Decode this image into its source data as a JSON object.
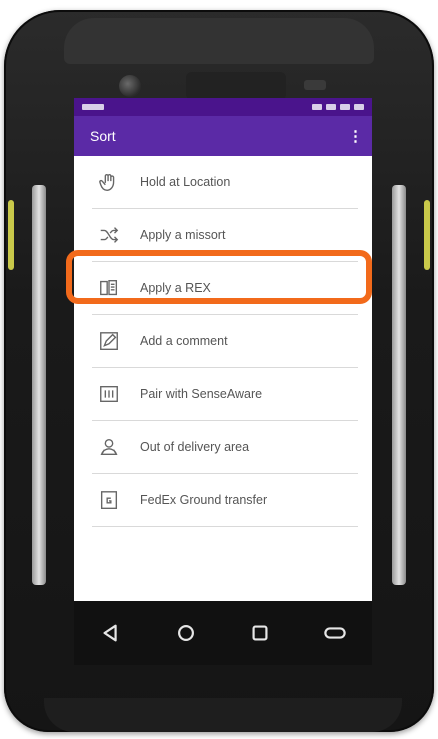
{
  "app": {
    "title": "Sort",
    "overflow_menu": "⋮"
  },
  "menu": {
    "items": [
      {
        "label": "Hold at Location",
        "icon": "hand-icon"
      },
      {
        "label": "Apply a missort",
        "icon": "shuffle-icon"
      },
      {
        "label": "Apply a REX",
        "icon": "book-icon"
      },
      {
        "label": "Add a comment",
        "icon": "pencil-icon"
      },
      {
        "label": "Pair with SenseAware",
        "icon": "sensor-icon"
      },
      {
        "label": "Out of delivery area",
        "icon": "person-pin-icon"
      },
      {
        "label": "FedEx Ground transfer",
        "icon": "ground-transfer-icon"
      }
    ],
    "highlighted_item": "Apply a REX"
  },
  "nav": {
    "buttons": [
      "back-icon",
      "home-icon",
      "recents-icon",
      "menu-pill-icon"
    ]
  },
  "colors": {
    "app_bar": "#5b2aa6",
    "status_bar": "#4a148c",
    "highlight": "#f26a1b"
  }
}
